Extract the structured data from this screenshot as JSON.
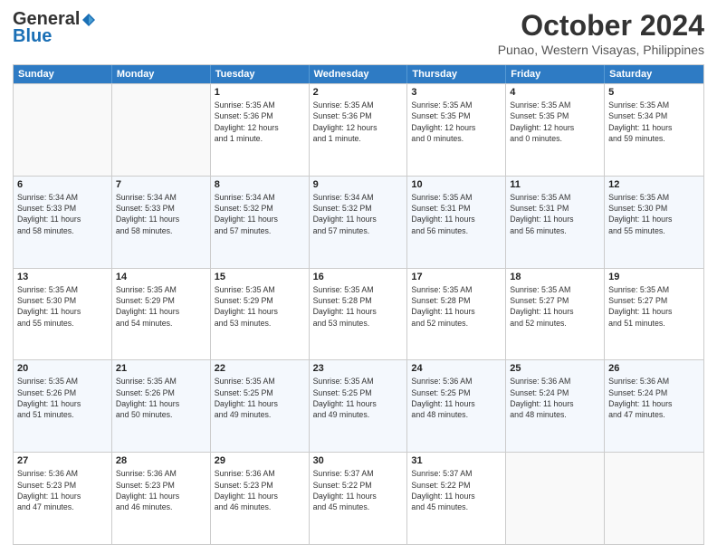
{
  "header": {
    "logo_general": "General",
    "logo_blue": "Blue",
    "title": "October 2024",
    "subtitle": "Punao, Western Visayas, Philippines"
  },
  "days_of_week": [
    "Sunday",
    "Monday",
    "Tuesday",
    "Wednesday",
    "Thursday",
    "Friday",
    "Saturday"
  ],
  "weeks": [
    [
      {
        "date": "",
        "info": ""
      },
      {
        "date": "",
        "info": ""
      },
      {
        "date": "1",
        "info": "Sunrise: 5:35 AM\nSunset: 5:36 PM\nDaylight: 12 hours\nand 1 minute."
      },
      {
        "date": "2",
        "info": "Sunrise: 5:35 AM\nSunset: 5:36 PM\nDaylight: 12 hours\nand 1 minute."
      },
      {
        "date": "3",
        "info": "Sunrise: 5:35 AM\nSunset: 5:35 PM\nDaylight: 12 hours\nand 0 minutes."
      },
      {
        "date": "4",
        "info": "Sunrise: 5:35 AM\nSunset: 5:35 PM\nDaylight: 12 hours\nand 0 minutes."
      },
      {
        "date": "5",
        "info": "Sunrise: 5:35 AM\nSunset: 5:34 PM\nDaylight: 11 hours\nand 59 minutes."
      }
    ],
    [
      {
        "date": "6",
        "info": "Sunrise: 5:34 AM\nSunset: 5:33 PM\nDaylight: 11 hours\nand 58 minutes."
      },
      {
        "date": "7",
        "info": "Sunrise: 5:34 AM\nSunset: 5:33 PM\nDaylight: 11 hours\nand 58 minutes."
      },
      {
        "date": "8",
        "info": "Sunrise: 5:34 AM\nSunset: 5:32 PM\nDaylight: 11 hours\nand 57 minutes."
      },
      {
        "date": "9",
        "info": "Sunrise: 5:34 AM\nSunset: 5:32 PM\nDaylight: 11 hours\nand 57 minutes."
      },
      {
        "date": "10",
        "info": "Sunrise: 5:35 AM\nSunset: 5:31 PM\nDaylight: 11 hours\nand 56 minutes."
      },
      {
        "date": "11",
        "info": "Sunrise: 5:35 AM\nSunset: 5:31 PM\nDaylight: 11 hours\nand 56 minutes."
      },
      {
        "date": "12",
        "info": "Sunrise: 5:35 AM\nSunset: 5:30 PM\nDaylight: 11 hours\nand 55 minutes."
      }
    ],
    [
      {
        "date": "13",
        "info": "Sunrise: 5:35 AM\nSunset: 5:30 PM\nDaylight: 11 hours\nand 55 minutes."
      },
      {
        "date": "14",
        "info": "Sunrise: 5:35 AM\nSunset: 5:29 PM\nDaylight: 11 hours\nand 54 minutes."
      },
      {
        "date": "15",
        "info": "Sunrise: 5:35 AM\nSunset: 5:29 PM\nDaylight: 11 hours\nand 53 minutes."
      },
      {
        "date": "16",
        "info": "Sunrise: 5:35 AM\nSunset: 5:28 PM\nDaylight: 11 hours\nand 53 minutes."
      },
      {
        "date": "17",
        "info": "Sunrise: 5:35 AM\nSunset: 5:28 PM\nDaylight: 11 hours\nand 52 minutes."
      },
      {
        "date": "18",
        "info": "Sunrise: 5:35 AM\nSunset: 5:27 PM\nDaylight: 11 hours\nand 52 minutes."
      },
      {
        "date": "19",
        "info": "Sunrise: 5:35 AM\nSunset: 5:27 PM\nDaylight: 11 hours\nand 51 minutes."
      }
    ],
    [
      {
        "date": "20",
        "info": "Sunrise: 5:35 AM\nSunset: 5:26 PM\nDaylight: 11 hours\nand 51 minutes."
      },
      {
        "date": "21",
        "info": "Sunrise: 5:35 AM\nSunset: 5:26 PM\nDaylight: 11 hours\nand 50 minutes."
      },
      {
        "date": "22",
        "info": "Sunrise: 5:35 AM\nSunset: 5:25 PM\nDaylight: 11 hours\nand 49 minutes."
      },
      {
        "date": "23",
        "info": "Sunrise: 5:35 AM\nSunset: 5:25 PM\nDaylight: 11 hours\nand 49 minutes."
      },
      {
        "date": "24",
        "info": "Sunrise: 5:36 AM\nSunset: 5:25 PM\nDaylight: 11 hours\nand 48 minutes."
      },
      {
        "date": "25",
        "info": "Sunrise: 5:36 AM\nSunset: 5:24 PM\nDaylight: 11 hours\nand 48 minutes."
      },
      {
        "date": "26",
        "info": "Sunrise: 5:36 AM\nSunset: 5:24 PM\nDaylight: 11 hours\nand 47 minutes."
      }
    ],
    [
      {
        "date": "27",
        "info": "Sunrise: 5:36 AM\nSunset: 5:23 PM\nDaylight: 11 hours\nand 47 minutes."
      },
      {
        "date": "28",
        "info": "Sunrise: 5:36 AM\nSunset: 5:23 PM\nDaylight: 11 hours\nand 46 minutes."
      },
      {
        "date": "29",
        "info": "Sunrise: 5:36 AM\nSunset: 5:23 PM\nDaylight: 11 hours\nand 46 minutes."
      },
      {
        "date": "30",
        "info": "Sunrise: 5:37 AM\nSunset: 5:22 PM\nDaylight: 11 hours\nand 45 minutes."
      },
      {
        "date": "31",
        "info": "Sunrise: 5:37 AM\nSunset: 5:22 PM\nDaylight: 11 hours\nand 45 minutes."
      },
      {
        "date": "",
        "info": ""
      },
      {
        "date": "",
        "info": ""
      }
    ]
  ]
}
